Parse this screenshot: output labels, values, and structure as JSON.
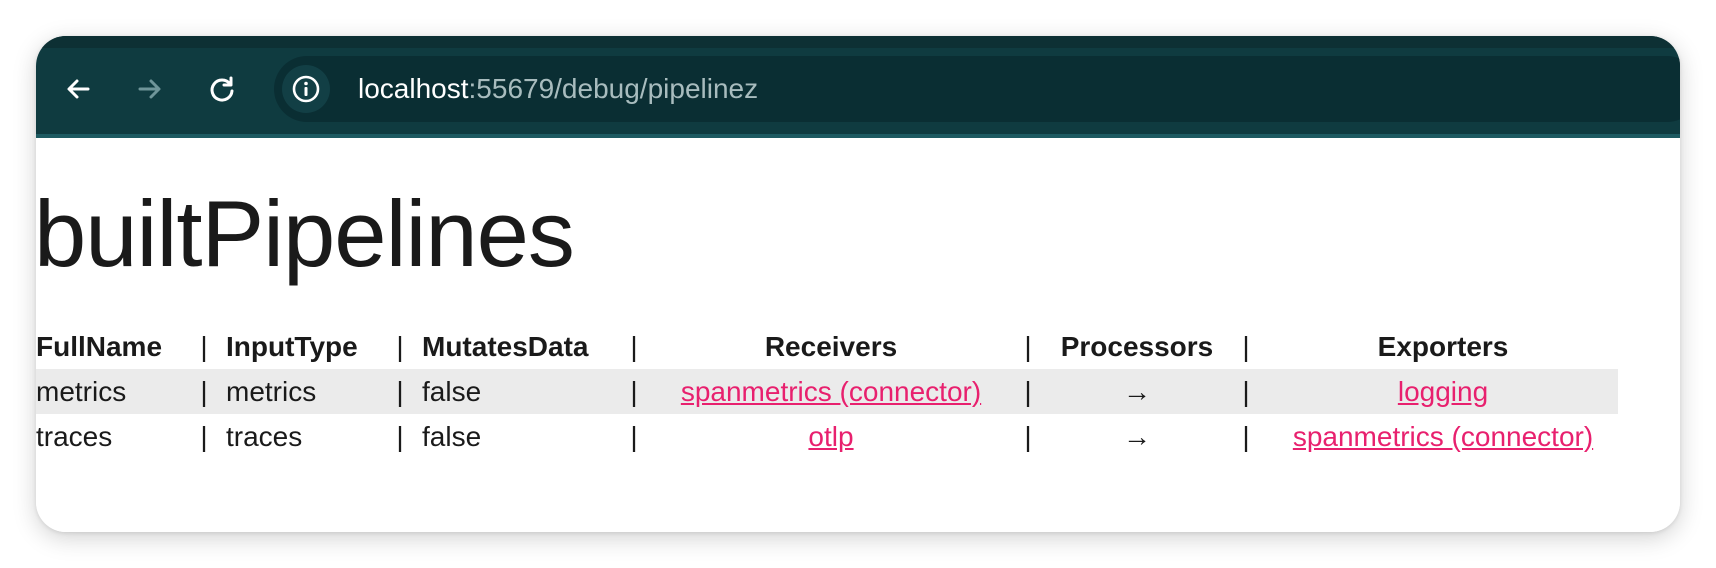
{
  "browser": {
    "url_host": "localhost",
    "url_path": ":55679/debug/pipelinez",
    "icons": {
      "back": "arrow-left-icon",
      "forward": "arrow-right-icon",
      "reload": "reload-icon",
      "site_info": "info-icon"
    }
  },
  "page": {
    "title": "builtPipelines",
    "separator": "|",
    "columns": [
      "FullName",
      "InputType",
      "MutatesData",
      "Receivers",
      "Processors",
      "Exporters"
    ],
    "rows": [
      {
        "full_name": "metrics",
        "input_type": "metrics",
        "mutates_data": "false",
        "receivers": "spanmetrics (connector)",
        "processors": "→",
        "exporters": "logging"
      },
      {
        "full_name": "traces",
        "input_type": "traces",
        "mutates_data": "false",
        "receivers": "otlp",
        "processors": "→",
        "exporters": "spanmetrics (connector)"
      }
    ]
  },
  "colors": {
    "toolbar_bg": "#0f3b40",
    "link": "#e8206e",
    "row_highlight": "#ebebeb"
  }
}
